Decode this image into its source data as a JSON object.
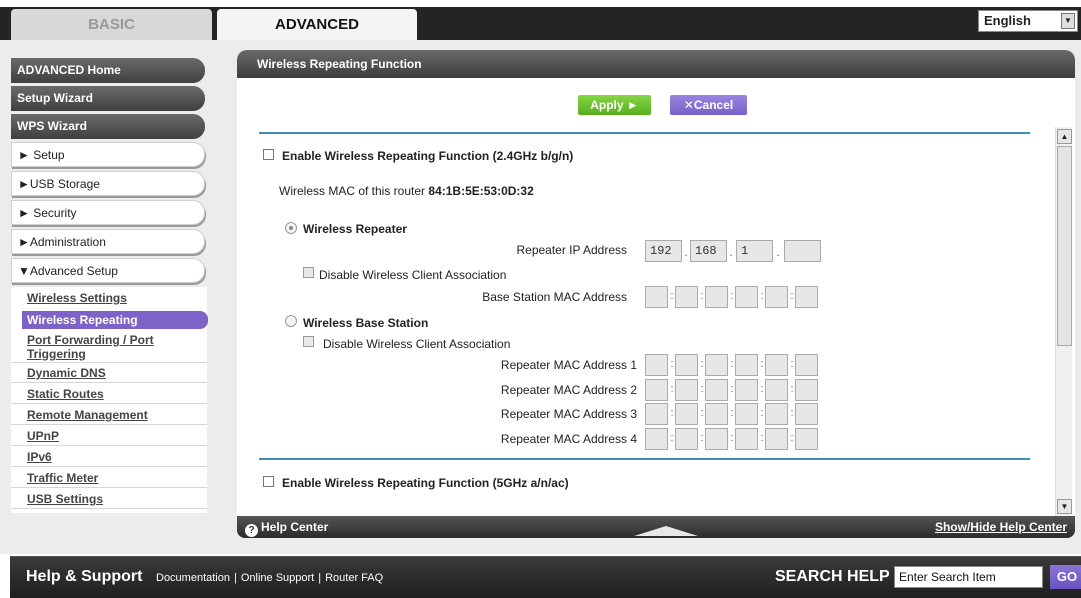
{
  "tabs": {
    "basic": "BASIC",
    "advanced": "ADVANCED"
  },
  "language": {
    "selected": "English"
  },
  "sidebar": {
    "items": [
      {
        "label": "ADVANCED Home"
      },
      {
        "label": "Setup Wizard"
      },
      {
        "label": "WPS Wizard"
      },
      {
        "label": "► Setup"
      },
      {
        "label": "►USB Storage"
      },
      {
        "label": "► Security"
      },
      {
        "label": "►Administration"
      },
      {
        "label": "▼Advanced Setup"
      }
    ],
    "submenu": [
      {
        "label": "Wireless Settings"
      },
      {
        "label": "Wireless Repeating"
      },
      {
        "label": "Port Forwarding / Port"
      },
      {
        "label": "Triggering"
      },
      {
        "label": "Dynamic DNS"
      },
      {
        "label": "Static Routes"
      },
      {
        "label": "Remote Management"
      },
      {
        "label": "UPnP"
      },
      {
        "label": "IPv6"
      },
      {
        "label": "Traffic Meter"
      },
      {
        "label": "USB Settings"
      }
    ]
  },
  "panel": {
    "title": "Wireless Repeating Function",
    "apply_label": "Apply ►",
    "cancel_label": "✕Cancel",
    "enable24_label": "Enable Wireless Repeating Function (2.4GHz b/g/n)",
    "mac_prefix": "Wireless MAC of this router",
    "mac_value": "84:1B:5E:53:0D:32",
    "repeater_label": "Wireless Repeater",
    "repeater_ip_label": "Repeater IP Address",
    "ip": [
      "192",
      "168",
      "1",
      ""
    ],
    "disable_assoc_label": "Disable Wireless Client Association",
    "base_mac_label": "Base Station MAC Address",
    "base_station_label": "Wireless Base Station",
    "disable_assoc_label2": "Disable Wireless Client Association",
    "rep_mac_labels": [
      "Repeater MAC Address 1",
      "Repeater MAC Address 2",
      "Repeater MAC Address 3",
      "Repeater MAC Address 4"
    ],
    "enable5_label": "Enable Wireless Repeating Function (5GHz a/n/ac)"
  },
  "helpbar": {
    "help_center": "Help Center",
    "show_hide": "Show/Hide Help Center"
  },
  "footer": {
    "help_support": "Help & Support",
    "links": [
      "Documentation",
      "Online Support",
      "Router FAQ"
    ],
    "search_help": "SEARCH HELP",
    "search_value": "Enter Search Item",
    "go": "GO"
  }
}
